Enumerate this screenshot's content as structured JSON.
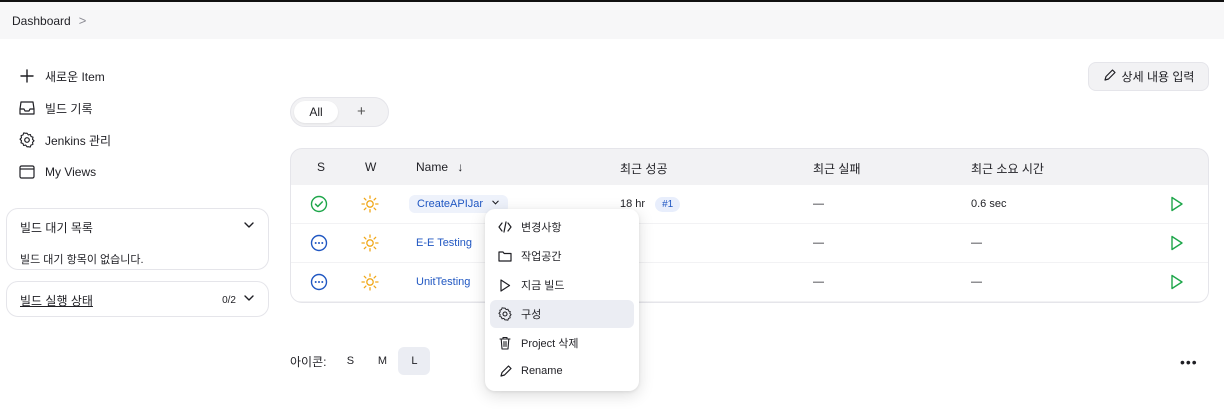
{
  "breadcrumb": {
    "dashboard": "Dashboard",
    "sep": ">"
  },
  "sidebar": {
    "items": [
      {
        "label": "새로운 Item",
        "icon": "plus-icon"
      },
      {
        "label": "빌드 기록",
        "icon": "inbox-icon"
      },
      {
        "label": "Jenkins 관리",
        "icon": "gear-icon"
      },
      {
        "label": "My Views",
        "icon": "window-icon"
      }
    ],
    "build_queue": {
      "title": "빌드 대기 목록",
      "empty": "빌드 대기 항목이 없습니다."
    },
    "executors": {
      "title": "빌드 실행 상태",
      "count": "0/2"
    }
  },
  "header": {
    "add_description": "상세 내용 입력"
  },
  "tabs": {
    "all": "All",
    "add": "+"
  },
  "table": {
    "columns": {
      "s": "S",
      "w": "W",
      "name": "Name",
      "sort": "↓",
      "last_success": "최근 성공",
      "last_failure": "최근 실패",
      "last_duration": "최근 소요 시간"
    },
    "rows": [
      {
        "status": "success",
        "name": "CreateAPIJar",
        "last_success": "18 hr",
        "build": "#1",
        "last_failure": "—",
        "duration": "0.6 sec"
      },
      {
        "status": "pending",
        "name": "E-E Testing",
        "last_success": "",
        "build": "",
        "last_failure": "—",
        "duration": "—"
      },
      {
        "status": "pending",
        "name": "UnitTesting",
        "last_success": "",
        "build": "",
        "last_failure": "—",
        "duration": "—"
      }
    ]
  },
  "icon_size": {
    "label": "아이콘:",
    "options": [
      "S",
      "M",
      "L"
    ],
    "selected": "L"
  },
  "menu": {
    "items": [
      {
        "label": "변경사항",
        "icon": "code-icon"
      },
      {
        "label": "작업공간",
        "icon": "folder-icon"
      },
      {
        "label": "지금 빌드",
        "icon": "play-icon"
      },
      {
        "label": "구성",
        "icon": "gear-icon"
      },
      {
        "label": "Project 삭제",
        "icon": "trash-icon"
      },
      {
        "label": "Rename",
        "icon": "pencil-icon"
      }
    ],
    "hovered": "구성"
  },
  "more": "•••",
  "colors": {
    "accent": "#2057c2",
    "success": "#1ea64a",
    "weather": "#f0a81b"
  }
}
